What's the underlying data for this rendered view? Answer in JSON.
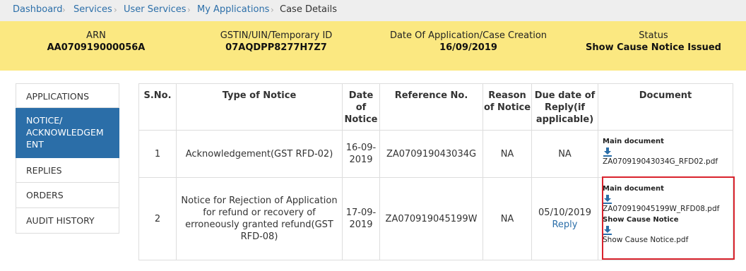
{
  "breadcrumb": {
    "items": [
      "Dashboard",
      "Services",
      "User Services",
      "My Applications"
    ],
    "current": "Case Details"
  },
  "case_info": {
    "arn_label": "ARN",
    "arn_value": "AA070919000056A",
    "gstin_label": "GSTIN/UIN/Temporary ID",
    "gstin_value": "07AQDPP8277H7Z7",
    "date_label": "Date Of Application/Case Creation",
    "date_value": "16/09/2019",
    "status_label": "Status",
    "status_value": "Show Cause Notice Issued"
  },
  "sidenav": {
    "items": [
      "APPLICATIONS",
      "NOTICE/ ACKNOWLEDGEM ENT",
      "REPLIES",
      "ORDERS",
      "AUDIT HISTORY"
    ],
    "active_index": 1
  },
  "table": {
    "headers": {
      "sno": "S.No.",
      "type": "Type of Notice",
      "date": "Date of Notice",
      "ref": "Reference No.",
      "reason": "Reason of Notice",
      "due": "Due date of Reply(if applicable)",
      "doc": "Document"
    },
    "rows": [
      {
        "sno": "1",
        "type": "Acknowledgement(GST RFD-02)",
        "date": "16-09-2019",
        "ref": "ZA070919043034G",
        "reason": "NA",
        "due": "NA",
        "docs": [
          {
            "title": "Main document",
            "file": "ZA070919043034G_RFD02.pdf"
          }
        ]
      },
      {
        "sno": "2",
        "type": "Notice for Rejection of Application for refund or recovery of erroneously granted refund(GST RFD-08)",
        "date": "17-09-2019",
        "ref": "ZA070919045199W",
        "reason": "NA",
        "due": "05/10/2019",
        "reply_link": "Reply",
        "docs": [
          {
            "title": "Main document",
            "file": "ZA070919045199W_RFD08.pdf"
          },
          {
            "title": "Show Cause Notice",
            "file": "Show Cause Notice.pdf"
          }
        ]
      }
    ]
  },
  "icons": {
    "download": "download-icon"
  },
  "colors": {
    "link": "#2c6fa9",
    "active_nav": "#2b6ea8",
    "info_bar": "#fbe881",
    "highlight": "#d9232d"
  }
}
